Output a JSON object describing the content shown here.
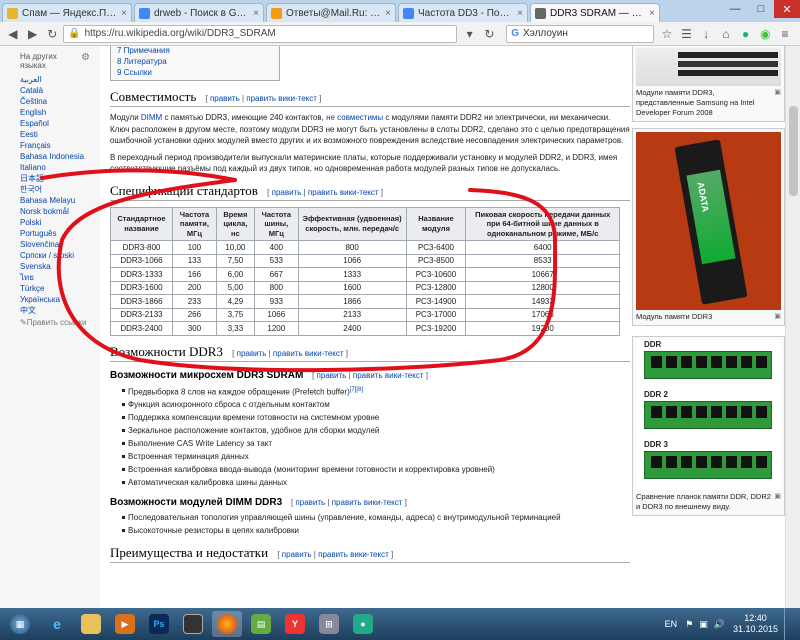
{
  "browser": {
    "tabs": [
      {
        "label": "Спам — Яндекс.Почта",
        "icon": "yandex-mail-icon",
        "color": "#e8b533",
        "active": false
      },
      {
        "label": "drweb - Поиск в Google",
        "icon": "google-icon",
        "color": "#4285f4",
        "active": false
      },
      {
        "label": "Ответы@Mail.Ru: какая ча",
        "icon": "mailru-icon",
        "color": "#f39c12",
        "active": false
      },
      {
        "label": "Частота DD3 - Поиск в Goo",
        "icon": "google-icon",
        "color": "#4285f4",
        "active": false
      },
      {
        "label": "DDR3 SDRAM — Википедия",
        "icon": "wikipedia-icon",
        "color": "#666666",
        "active": true
      }
    ],
    "url": "https://ru.wikipedia.org/wiki/DDR3_SDRAM",
    "search_value": "Хэллоуин"
  },
  "sidebar": {
    "heading": "На других языках",
    "languages": [
      "العربية",
      "Català",
      "Čeština",
      "English",
      "Español",
      "Eesti",
      "Français",
      "Bahasa Indonesia",
      "Italiano",
      "日本語",
      "한국어",
      "Bahasa Melayu",
      "Norsk bokmål",
      "Polski",
      "Português",
      "Slovenčina",
      "Српски / srpski",
      "Svenska",
      "ไทย",
      "Türkçe",
      "Українська",
      "中文"
    ],
    "edit_links": "Править ссылки"
  },
  "toc": [
    "7 Примечания",
    "8 Литература",
    "9 Ссылки"
  ],
  "edit": {
    "edit": "править",
    "edit_wiki": "править вики-текст"
  },
  "compat": {
    "title": "Совместимость",
    "p1_a": "Модули ",
    "p1_link1": "DIMM",
    "p1_b": " с памятью DDR3, имеющие 240 контактов, ",
    "p1_link2": "не совместимы",
    "p1_c": " с модулями памяти DDR2 ни электрически, ни механически. Ключ расположен в другом месте, поэтому модули DDR3 не могут быть установлены в слоты DDR2, сделано это с целью предотвращения ошибочной установки одних модулей вместо других и их возможного повреждения вследствие несовпадения электрических параметров.",
    "p2": "В переходный период производители выпускали материнские платы, которые поддерживали установку и модулей DDR2, и DDR3, имея соответствующие разъёмы под каждый из двух типов, но одновременная работа модулей разных типов не допускалась."
  },
  "spec": {
    "title": "Спецификации стандартов",
    "headers": [
      "Стандартное название",
      "Частота памяти, МГц",
      "Время цикла, нс",
      "Частота шины, МГц",
      "Эффективная (удвоенная) скорость, млн. передач/с",
      "Название модуля",
      "Пиковая скорость передачи данных при 64-битной шине данных в одноканальном режиме, МБ/с"
    ],
    "rows": [
      [
        "DDR3-800",
        "100",
        "10,00",
        "400",
        "800",
        "PC3-6400",
        "6400"
      ],
      [
        "DDR3-1066",
        "133",
        "7,50",
        "533",
        "1066",
        "PC3-8500",
        "8533"
      ],
      [
        "DDR3-1333",
        "166",
        "6,00",
        "667",
        "1333",
        "PC3-10600",
        "10667"
      ],
      [
        "DDR3-1600",
        "200",
        "5,00",
        "800",
        "1600",
        "PC3-12800",
        "12800"
      ],
      [
        "DDR3-1866",
        "233",
        "4,29",
        "933",
        "1866",
        "PC3-14900",
        "14933"
      ],
      [
        "DDR3-2133",
        "266",
        "3,75",
        "1066",
        "2133",
        "PC3-17000",
        "17066"
      ],
      [
        "DDR3-2400",
        "300",
        "3,33",
        "1200",
        "2400",
        "PC3-19200",
        "19200"
      ]
    ]
  },
  "features": {
    "title": "Возможности DDR3",
    "chip_title": "Возможности микросхем DDR3 SDRAM",
    "chip_items": [
      "Предвыборка 8 слов на каждое обращение (Prefetch buffer)",
      "Функция асинхронного сброса с отдельным контактом",
      "Поддержка компенсации времени готовности на системном уровне",
      "Зеркальное расположение контактов, удобное для сборки модулей",
      "Выполнение CAS Write Latency за такт",
      "Встроенная терминация данных",
      "Встроенная калибровка ввода-вывода (мониторинг времени готовности и корректировка уровней)",
      "Автоматическая калибровка шины данных"
    ],
    "chip_ref": "[7][8]",
    "module_title": "Возможности модулей DIMM DDR3",
    "module_items": [
      "Последовательная топология управляющей шины (управление, команды, адреса) с внутримодульной терминацией",
      "Высокоточные резисторы в цепях калибровки"
    ]
  },
  "advantages": {
    "title": "Преимущества и недостатки"
  },
  "right": {
    "cap1": "Модули памяти DDR3, представленные Samsung на Intel Developer Forum 2008",
    "module_brand": "ADATA",
    "cap2": "Модуль памяти DDR3",
    "labels": [
      "DDR",
      "DDR 2",
      "DDR 3"
    ],
    "cap3": "Сравнение планок памяти DDR, DDR2 и DDR3 по внешнему виду."
  },
  "taskbar": {
    "lang": "EN",
    "time": "12:40",
    "date": "31.10.2015"
  },
  "colors": {
    "annotation": "#e0101a",
    "link": "#0645ad",
    "taskbar": "#2b5274"
  }
}
